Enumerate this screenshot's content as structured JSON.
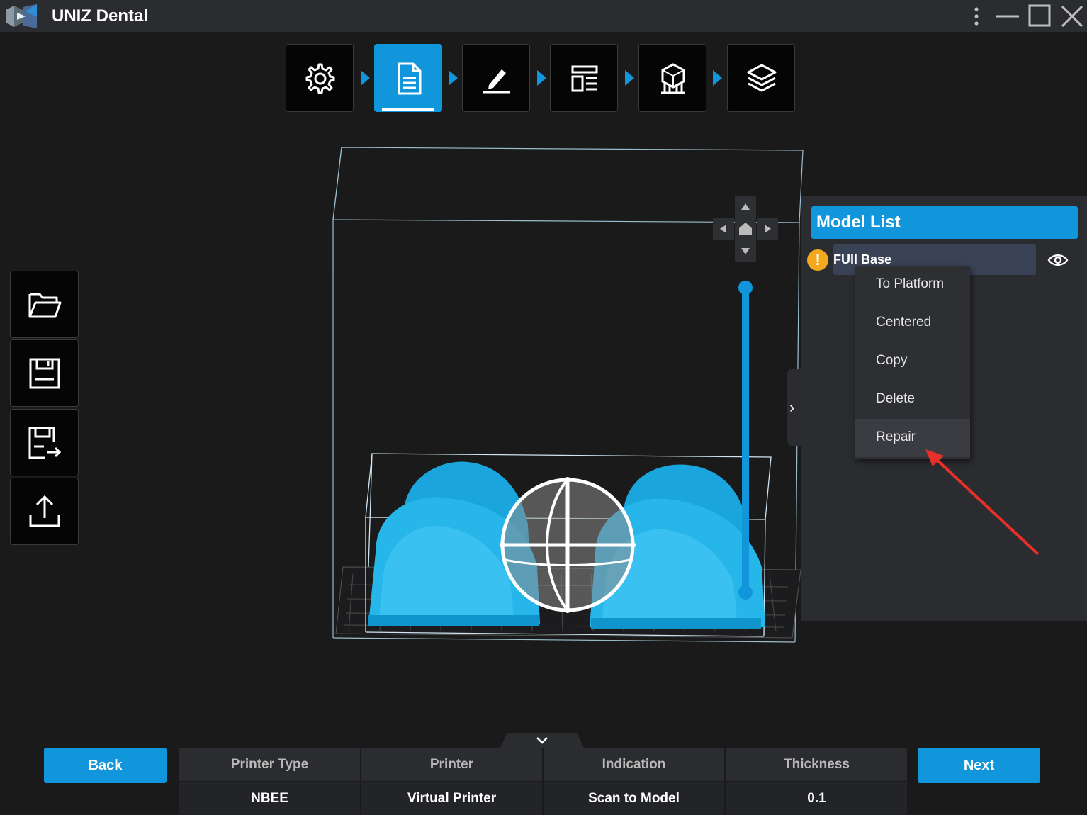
{
  "app": {
    "title": "UNIZ Dental"
  },
  "workflow_steps": [
    {
      "icon": "gear-icon",
      "active": false
    },
    {
      "icon": "document-icon",
      "active": true
    },
    {
      "icon": "edit-pen-icon",
      "active": false
    },
    {
      "icon": "layout-icon",
      "active": false
    },
    {
      "icon": "support-structure-icon",
      "active": false
    },
    {
      "icon": "layers-icon",
      "active": false
    }
  ],
  "side_toolbar": [
    {
      "icon": "folder-open-icon"
    },
    {
      "icon": "save-icon"
    },
    {
      "icon": "save-as-icon"
    },
    {
      "icon": "upload-icon"
    }
  ],
  "model_list": {
    "title": "Model List",
    "items": [
      {
        "name": "FUll Base",
        "status": "warning",
        "visible": true
      }
    ]
  },
  "context_menu": {
    "items": [
      "To Platform",
      "Centered",
      "Copy",
      "Delete",
      "Repair"
    ],
    "hovered": "Repair"
  },
  "footer": {
    "back_label": "Back",
    "next_label": "Next",
    "columns": [
      {
        "header": "Printer Type",
        "value": "NBEE"
      },
      {
        "header": "Printer",
        "value": "Virtual Printer"
      },
      {
        "header": "Indication",
        "value": "Scan to Model"
      },
      {
        "header": "Thickness",
        "value": "0.1"
      }
    ]
  },
  "colors": {
    "accent": "#1296db",
    "background": "#1a1a1a",
    "panel": "#2b2c30",
    "model": "#2ab7ec",
    "warning": "#f4a81d",
    "annotation_arrow": "#e8302a"
  }
}
